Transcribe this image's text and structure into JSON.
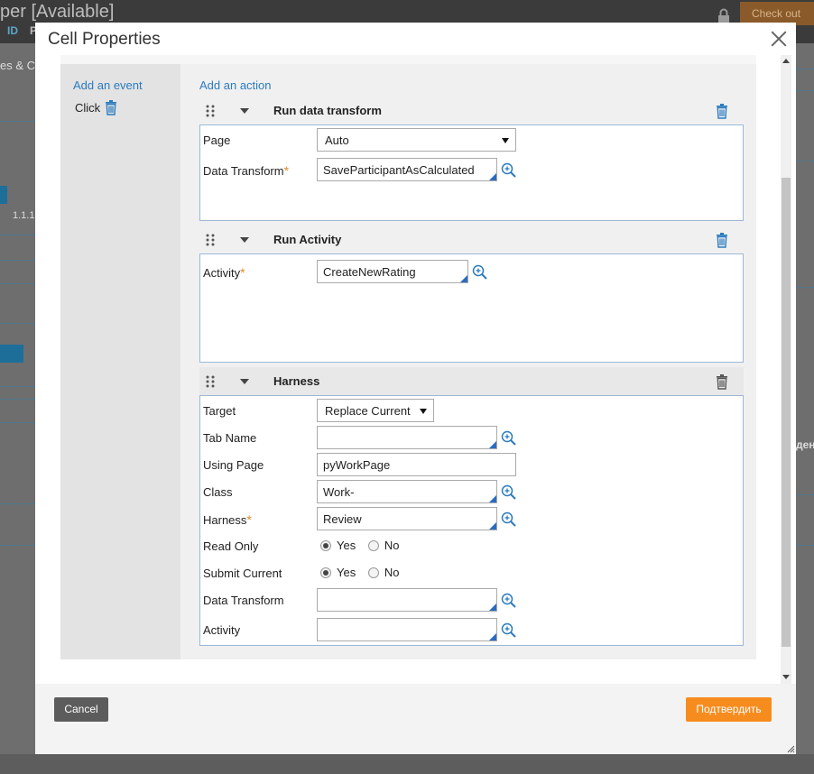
{
  "background": {
    "title": "per [Available]",
    "tab_id": "ID",
    "tab_p": "P",
    "checkout_label": "Check out",
    "left_snippet": "es & C",
    "row_label": "1.1.1",
    "right_snippet": "ден"
  },
  "dialog": {
    "title": "Cell Properties",
    "add_event_label": "Add an event",
    "event_name": "Click",
    "add_action_label": "Add an action"
  },
  "actions": [
    {
      "title": "Run data transform",
      "fields": {
        "page_label": "Page",
        "page_value": "Auto",
        "dt_label": "Data Transform",
        "dt_value": "SaveParticipantAsCalculated"
      }
    },
    {
      "title": "Run Activity",
      "fields": {
        "activity_label": "Activity",
        "activity_value": "CreateNewRating"
      }
    },
    {
      "title": "Harness",
      "fields": {
        "target_label": "Target",
        "target_value": "Replace Current",
        "tab_name_label": "Tab Name",
        "tab_name_value": "",
        "using_page_label": "Using Page",
        "using_page_value": "pyWorkPage",
        "class_label": "Class",
        "class_value": "Work-",
        "harness_label": "Harness",
        "harness_value": "Review",
        "read_only_label": "Read Only",
        "submit_current_label": "Submit Current",
        "yes_label": "Yes",
        "no_label": "No",
        "dt_label": "Data Transform",
        "dt_value": "",
        "activity_label": "Activity",
        "activity_value": ""
      }
    }
  ],
  "footer": {
    "cancel_label": "Cancel",
    "confirm_label": "Подтвердить"
  },
  "colors": {
    "accent": "#2b7bbf",
    "confirm": "#f78c1e",
    "required": "#e08a2a"
  }
}
